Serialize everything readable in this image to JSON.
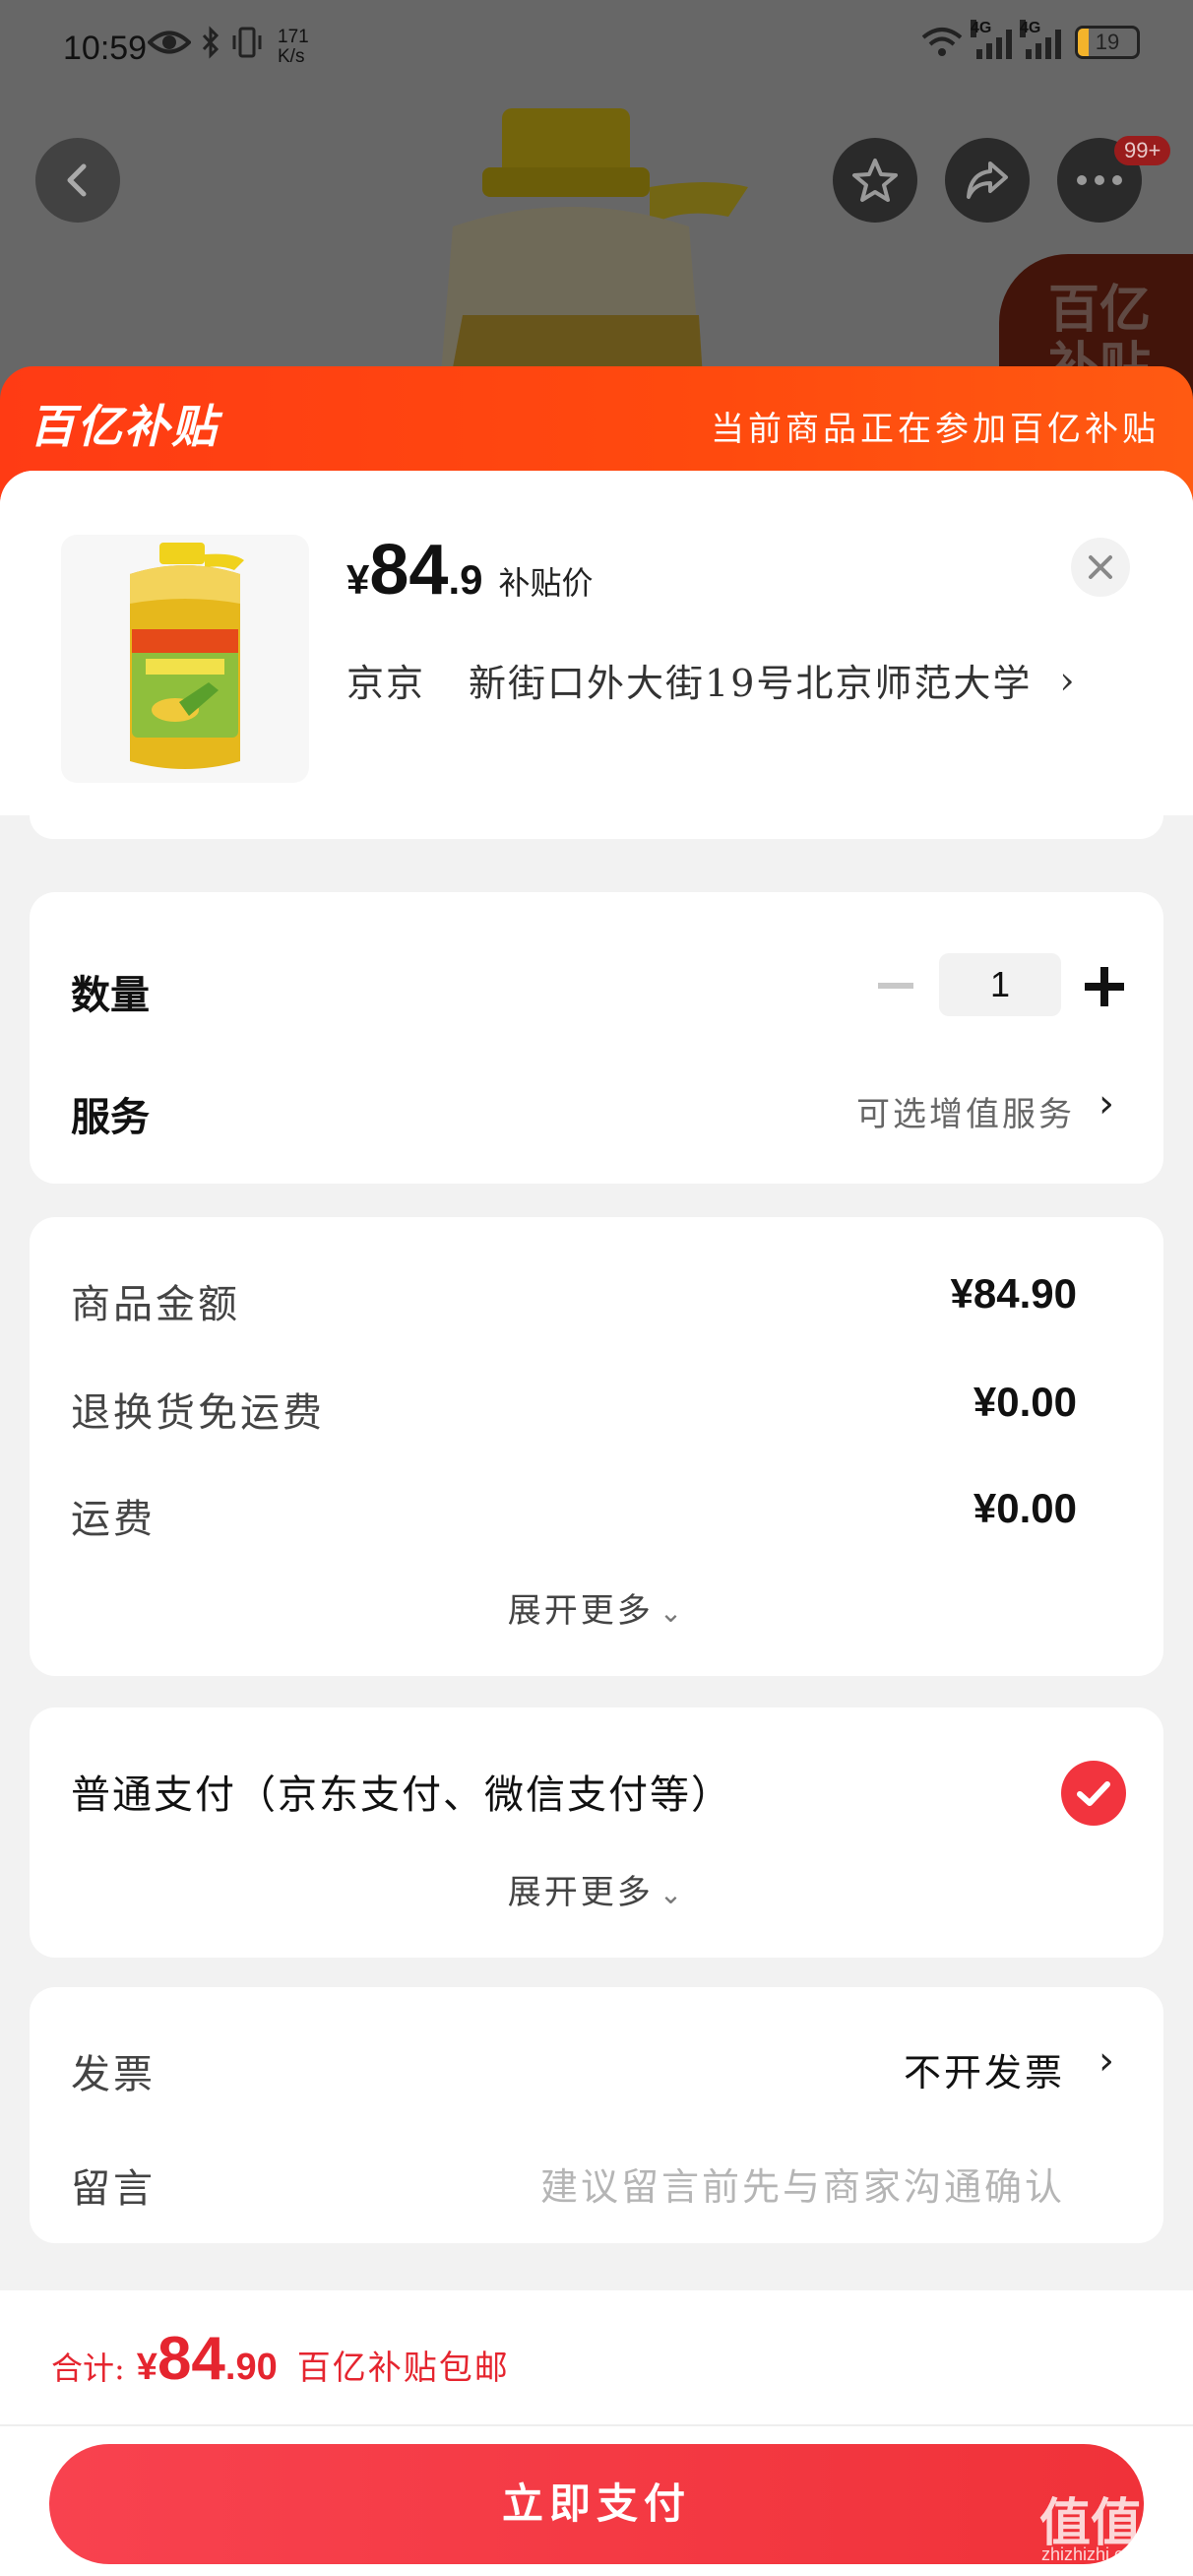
{
  "status_bar": {
    "time": "10:59",
    "net_speed_value": "171",
    "net_speed_unit": "K/s",
    "signal_tag_1": "4G",
    "signal_tag_2": "4G",
    "battery_level": "19",
    "battery_fraction": 0.19,
    "battery_color": "#f3b32b"
  },
  "product_nav": {
    "more_badge": "99+",
    "bg_tag_line1": "百亿",
    "bg_tag_line2": "补贴"
  },
  "banner": {
    "logo_text": "百亿补贴",
    "message": "当前商品正在参加百亿补贴",
    "color": "#ff4a0e"
  },
  "product": {
    "price_symbol": "¥",
    "price_int": "84",
    "price_dec": ".9",
    "price_label": "补贴价",
    "address_city": "京京",
    "address_detail": "新街口外大街19号北京师范大学",
    "address_chevron": "›"
  },
  "quantity_card": {
    "quantity_label": "数量",
    "quantity_value": "1",
    "service_label": "服务",
    "service_value": "可选增值服务",
    "chevron": "›"
  },
  "amount_card": {
    "rows": [
      {
        "label": "商品金额",
        "value": "¥84.90"
      },
      {
        "label": "退换货免运费",
        "value": "¥0.00"
      },
      {
        "label": "运费",
        "value": "¥0.00"
      }
    ],
    "expand_label": "展开更多",
    "expand_caret": "⌄"
  },
  "payment_card": {
    "method": "普通支付（京东支付、微信支付等）",
    "expand_label": "展开更多",
    "expand_caret": "⌄",
    "check_color": "#f2343e"
  },
  "invoice_card": {
    "invoice_label": "发票",
    "invoice_value": "不开发票",
    "chevron": "›",
    "message_label": "留言",
    "message_placeholder": "建议留言前先与商家沟通确认"
  },
  "footer": {
    "total_label": "合计:",
    "total_symbol": "¥",
    "total_int": "84",
    "total_dec": ".90",
    "total_note": "百亿补贴包邮",
    "pay_button": "立即支付",
    "accent_color": "#e5252f"
  },
  "watermark": {
    "text": "值值值",
    "sub": "zhizhizhi.com"
  }
}
